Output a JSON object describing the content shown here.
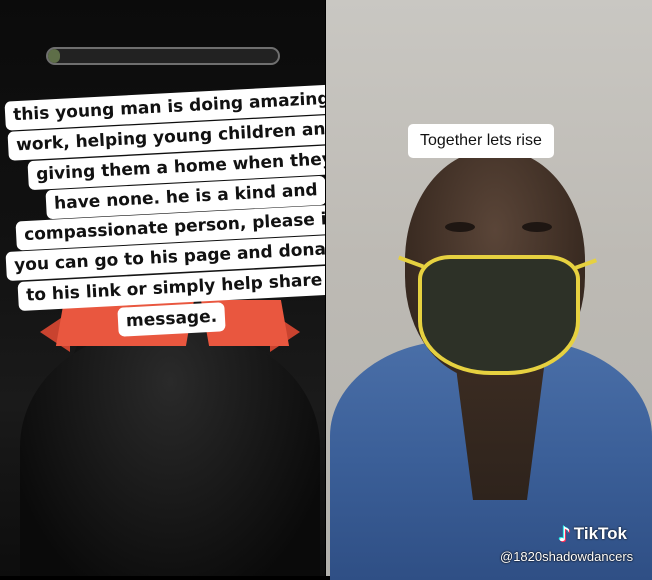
{
  "left_caption": {
    "lines": [
      "this young man is doing amazing",
      "work, helping young children and",
      "giving them a home when they",
      "have none. he is a kind and",
      "compassionate person, please if",
      "you can go to his page and donate",
      "to his link or simply help share his",
      "message."
    ]
  },
  "right_caption": "Together lets rise",
  "watermark": {
    "brand": "TikTok",
    "handle": "@1820shadowdancers",
    "icon": "tiktok-note-icon"
  },
  "progress": {
    "fraction": 0.05
  },
  "colors": {
    "ribbon": "#e9573f",
    "mask_trim": "#e6d140",
    "shirt": "#3b5f98"
  }
}
